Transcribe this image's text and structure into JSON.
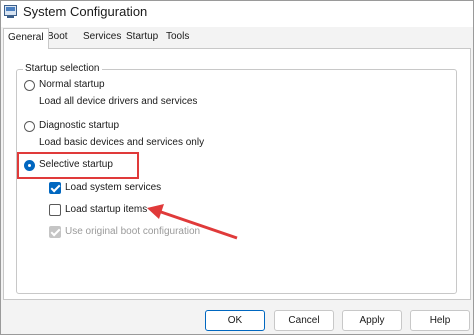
{
  "window": {
    "title": "System Configuration"
  },
  "tabs": [
    {
      "label": "General",
      "active": true
    },
    {
      "label": "Boot",
      "active": false
    },
    {
      "label": "Services",
      "active": false
    },
    {
      "label": "Startup",
      "active": false
    },
    {
      "label": "Tools",
      "active": false
    }
  ],
  "startup_selection": {
    "group_label": "Startup selection",
    "normal": {
      "label": "Normal startup",
      "description": "Load all device drivers and services",
      "selected": false
    },
    "diagnostic": {
      "label": "Diagnostic startup",
      "description": "Load basic devices and services only",
      "selected": false
    },
    "selective": {
      "label": "Selective startup",
      "selected": true,
      "options": {
        "system_services": {
          "label": "Load system services",
          "checked": true
        },
        "startup_items": {
          "label": "Load startup items",
          "checked": false
        },
        "boot_config": {
          "label": "Use original boot configuration",
          "checked": true,
          "disabled": true
        }
      }
    }
  },
  "footer": {
    "ok": "OK",
    "cancel": "Cancel",
    "apply": "Apply",
    "help": "Help"
  },
  "colors": {
    "accent": "#0067c0",
    "annotation": "#e03a3a"
  }
}
